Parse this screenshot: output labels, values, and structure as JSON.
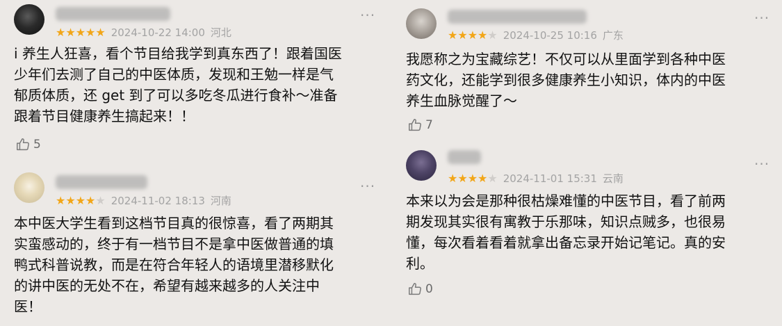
{
  "reviews": [
    {
      "date": "2024-10-22 14:00",
      "region": "河北",
      "rating": 5,
      "text": "i 养生人狂喜，看个节目给我学到真东西了！跟着国医\n少年们去测了自己的中医体质，发现和王勉一样是气\n郁质体质，还 get 到了可以多吃冬瓜进行食补～准备\n跟着节目健康养生搞起来！！",
      "likes": "5"
    },
    {
      "date": "2024-11-02 18:13",
      "region": "河南",
      "rating": 4,
      "text": "本中医大学生看到这档节目真的很惊喜，看了两期其\n实蛮感动的，终于有一档节目不是拿中医做普通的填\n鸭式科普说教，而是在符合年轻人的语境里潜移默化\n的讲中医的无处不在，希望有越来越多的人关注中\n医！",
      "likes": ""
    },
    {
      "date": "2024-10-25 10:16",
      "region": "广东",
      "rating": 4,
      "text": "我愿称之为宝藏综艺！不仅可以从里面学到各种中医\n药文化，还能学到很多健康养生小知识，体内的中医\n养生血脉觉醒了～",
      "likes": "7"
    },
    {
      "date": "2024-11-01 15:31",
      "region": "云南",
      "rating": 4,
      "text": "本来以为会是那种很枯燥难懂的中医节目，看了前两\n期发现其实很有寓教于乐那味，知识点贼多，也很易\n懂，每次看着看着就拿出备忘录开始记笔记。真的安\n利。",
      "likes": "0"
    }
  ],
  "icons": {
    "more": "more-dots-icon",
    "like": "thumb-up-icon",
    "star_on_color": "#f2a618",
    "star_off_color": "#d0cdca"
  }
}
